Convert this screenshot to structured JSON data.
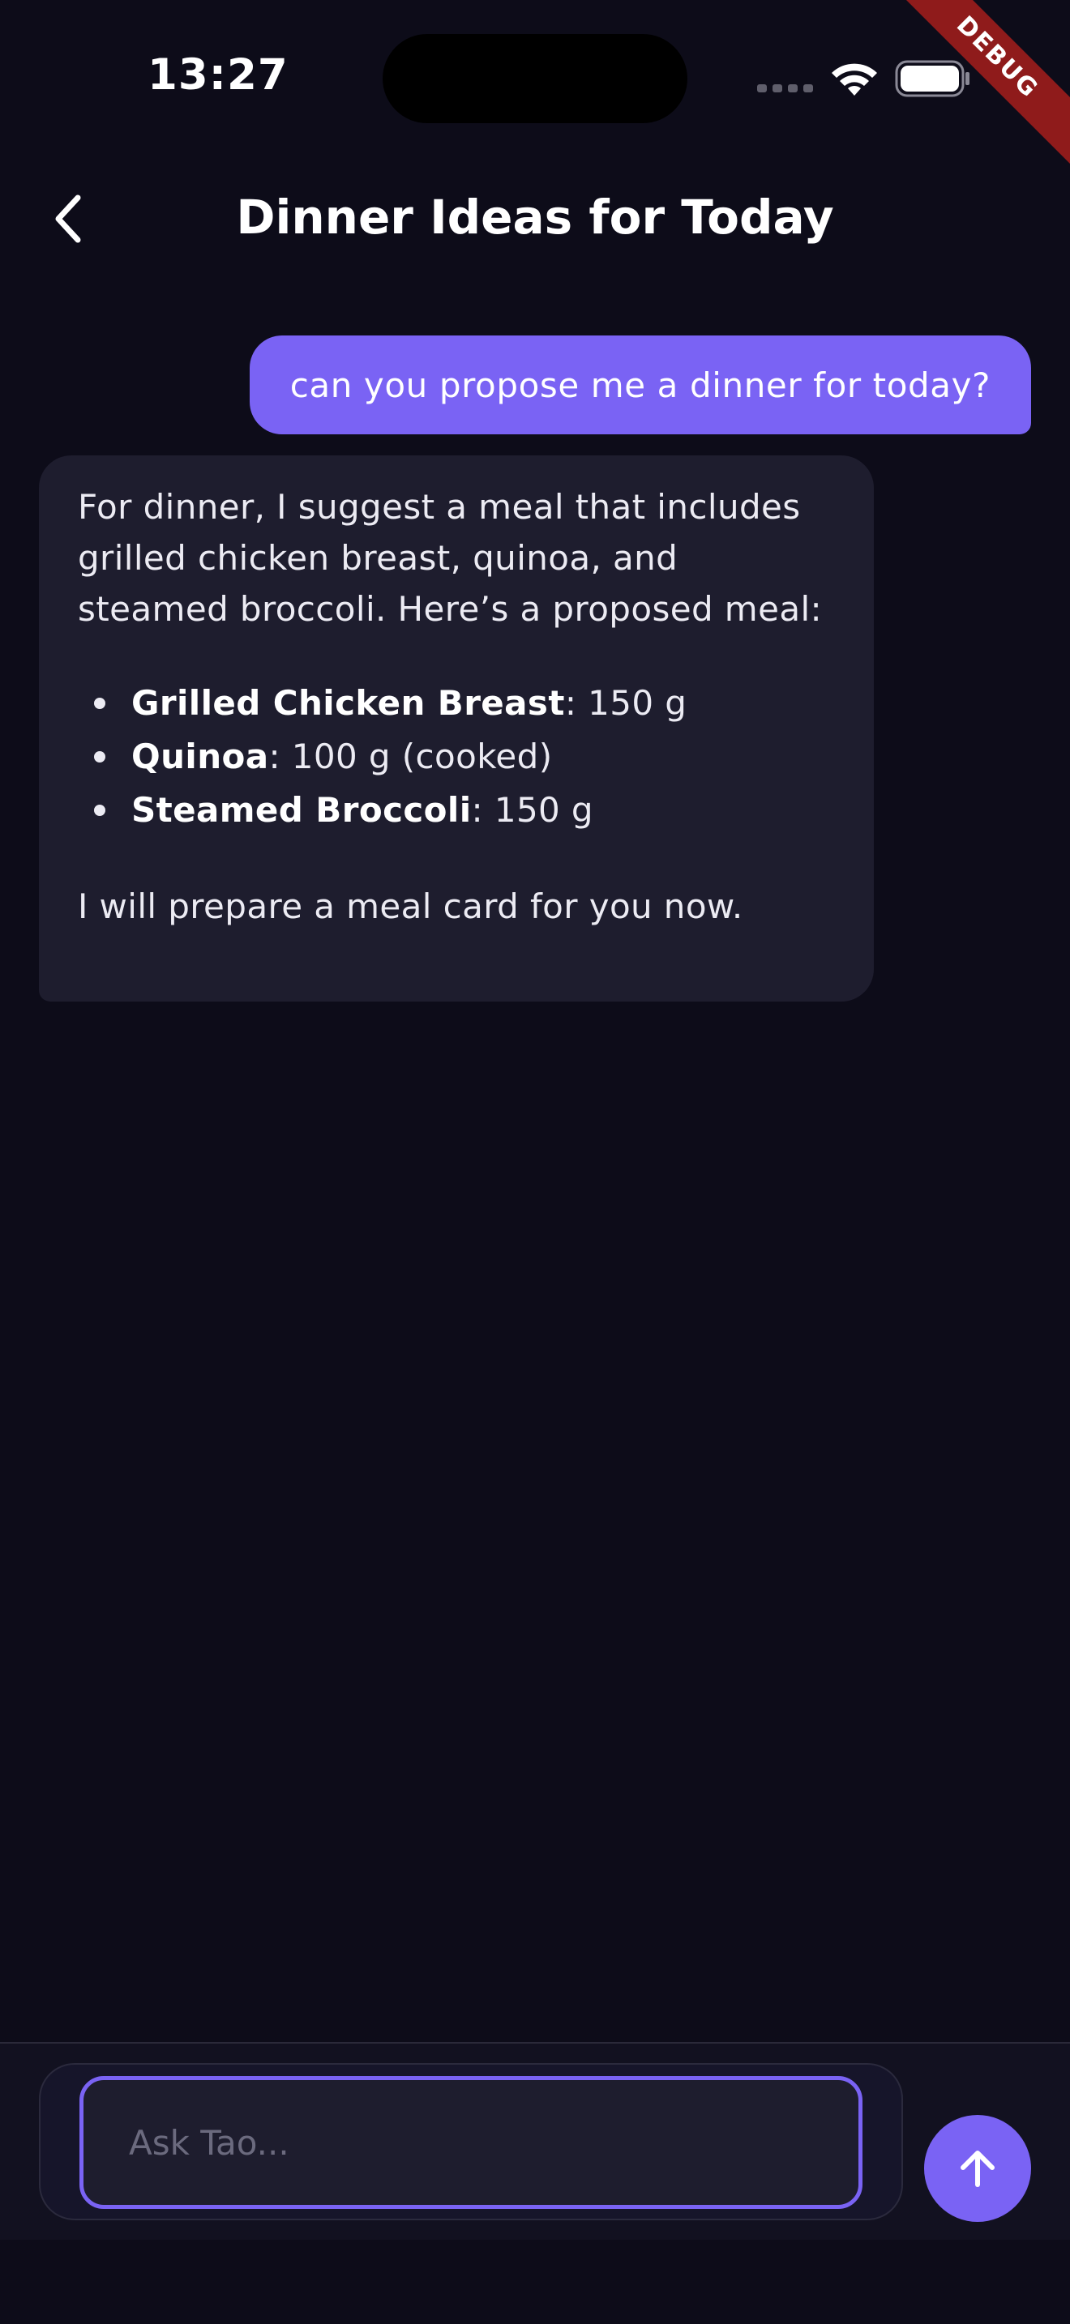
{
  "status_bar": {
    "time": "13:27",
    "icons": [
      "signal-icon",
      "wifi-icon",
      "battery-icon"
    ]
  },
  "debug_banner": "DEBUG",
  "header": {
    "back_icon": "chevron-left-icon",
    "title": "Dinner Ideas for Today"
  },
  "messages": {
    "user": "can you propose me a dinner for today?",
    "assistant": {
      "intro": "For dinner, I suggest a meal that includes grilled chicken breast, quinoa, and steamed broccoli. Here’s a proposed meal:",
      "items": [
        {
          "name": "Grilled Chicken Breast",
          "amount": ": 150 g"
        },
        {
          "name": "Quinoa",
          "amount": ": 100 g (cooked)"
        },
        {
          "name": "Steamed Broccoli",
          "amount": ": 150 g"
        }
      ],
      "outro": "I will prepare a meal card for you now."
    }
  },
  "composer": {
    "placeholder": "Ask Tao...",
    "value": "",
    "send_icon": "arrow-up-icon"
  },
  "colors": {
    "background": "#0d0c19",
    "accent": "#7a63f4",
    "bubble": "#1e1d2e",
    "debug": "#8f1b1b"
  }
}
